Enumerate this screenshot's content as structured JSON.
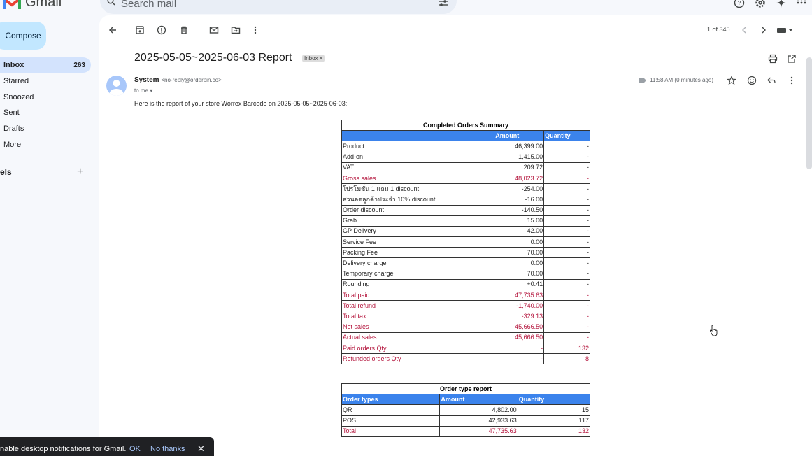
{
  "app": {
    "name": "Gmail"
  },
  "search": {
    "placeholder": "Search mail"
  },
  "sidebar": {
    "compose_label": "Compose",
    "items": [
      {
        "label": "Inbox",
        "count": "263"
      },
      {
        "label": "Starred"
      },
      {
        "label": "Snoozed"
      },
      {
        "label": "Sent"
      },
      {
        "label": "Drafts"
      },
      {
        "label": "More"
      }
    ],
    "labels_heading": "els",
    "labels_add": "+"
  },
  "toolbar": {
    "pager": "1 of 345"
  },
  "email": {
    "subject": "2025-05-05~2025-06-03 Report",
    "chip": "Inbox ×",
    "sender_name": "System",
    "sender_email": "<no-reply@orderpin.co>",
    "to": "to me ▾",
    "time": "11:58 AM (0 minutes ago)",
    "intro": "Here is the report of your store Worrex Barcode on 2025-05-05~2025-06-03:"
  },
  "report1": {
    "caption": "Completed Orders Summary",
    "headers": [
      "",
      "Amount",
      "Quantity"
    ],
    "rows": [
      {
        "label": "Product",
        "amount": "46,399.00",
        "qty": "-",
        "red": false
      },
      {
        "label": "Add-on",
        "amount": "1,415.00",
        "qty": "-",
        "red": false
      },
      {
        "label": "VAT",
        "amount": "209.72",
        "qty": "-",
        "red": false
      },
      {
        "label": "Gross sales",
        "amount": "48,023.72",
        "qty": "-",
        "red": true
      },
      {
        "label": "โปรโมชั่น 1 แถม 1 discount",
        "amount": "-254.00",
        "qty": "-",
        "red": false
      },
      {
        "label": "ส่วนลดลูกค้าประจำ 10% discount",
        "amount": "-16.00",
        "qty": "-",
        "red": false
      },
      {
        "label": "Order discount",
        "amount": "-140.50",
        "qty": "-",
        "red": false
      },
      {
        "label": "Grab",
        "amount": "15.00",
        "qty": "-",
        "red": false
      },
      {
        "label": "GP Delivery",
        "amount": "42.00",
        "qty": "-",
        "red": false
      },
      {
        "label": "Service Fee",
        "amount": "0.00",
        "qty": "-",
        "red": false
      },
      {
        "label": "Packing Fee",
        "amount": "70.00",
        "qty": "-",
        "red": false
      },
      {
        "label": "Delivery charge",
        "amount": "0.00",
        "qty": "-",
        "red": false
      },
      {
        "label": "Temporary charge",
        "amount": "70.00",
        "qty": "-",
        "red": false
      },
      {
        "label": "Rounding",
        "amount": "+0.41",
        "qty": "-",
        "red": false
      },
      {
        "label": "Total paid",
        "amount": "47,735.63",
        "qty": "-",
        "red": true
      },
      {
        "label": "Total refund",
        "amount": "-1,740.00",
        "qty": "-",
        "red": true
      },
      {
        "label": "Total tax",
        "amount": "-329.13",
        "qty": "-",
        "red": true
      },
      {
        "label": "Net sales",
        "amount": "45,666.50",
        "qty": "-",
        "red": true
      },
      {
        "label": "Actual sales",
        "amount": "45,666.50",
        "qty": "-",
        "red": true
      },
      {
        "label": "Paid orders Qty",
        "amount": "-",
        "qty": "132",
        "red": true
      },
      {
        "label": "Refunded orders Qty",
        "amount": "-",
        "qty": "8",
        "red": true
      }
    ]
  },
  "report2": {
    "caption": "Order type report",
    "headers": [
      "Order types",
      "Amount",
      "Quantity"
    ],
    "rows": [
      {
        "label": "QR",
        "amount": "4,802.00",
        "qty": "15",
        "red": false
      },
      {
        "label": "POS",
        "amount": "42,933.63",
        "qty": "117",
        "red": false
      },
      {
        "label": "Total",
        "amount": "47,735.63",
        "qty": "132",
        "red": true
      }
    ]
  },
  "notification": {
    "text": "nable desktop notifications for Gmail.",
    "ok": "OK",
    "no_thanks": "No thanks",
    "close": "✕"
  },
  "colors": {
    "header_blue": "#3b83ec",
    "red_text": "#b3123a",
    "compose_bg": "#c2e7ff",
    "active_nav": "#d3e3fd"
  }
}
